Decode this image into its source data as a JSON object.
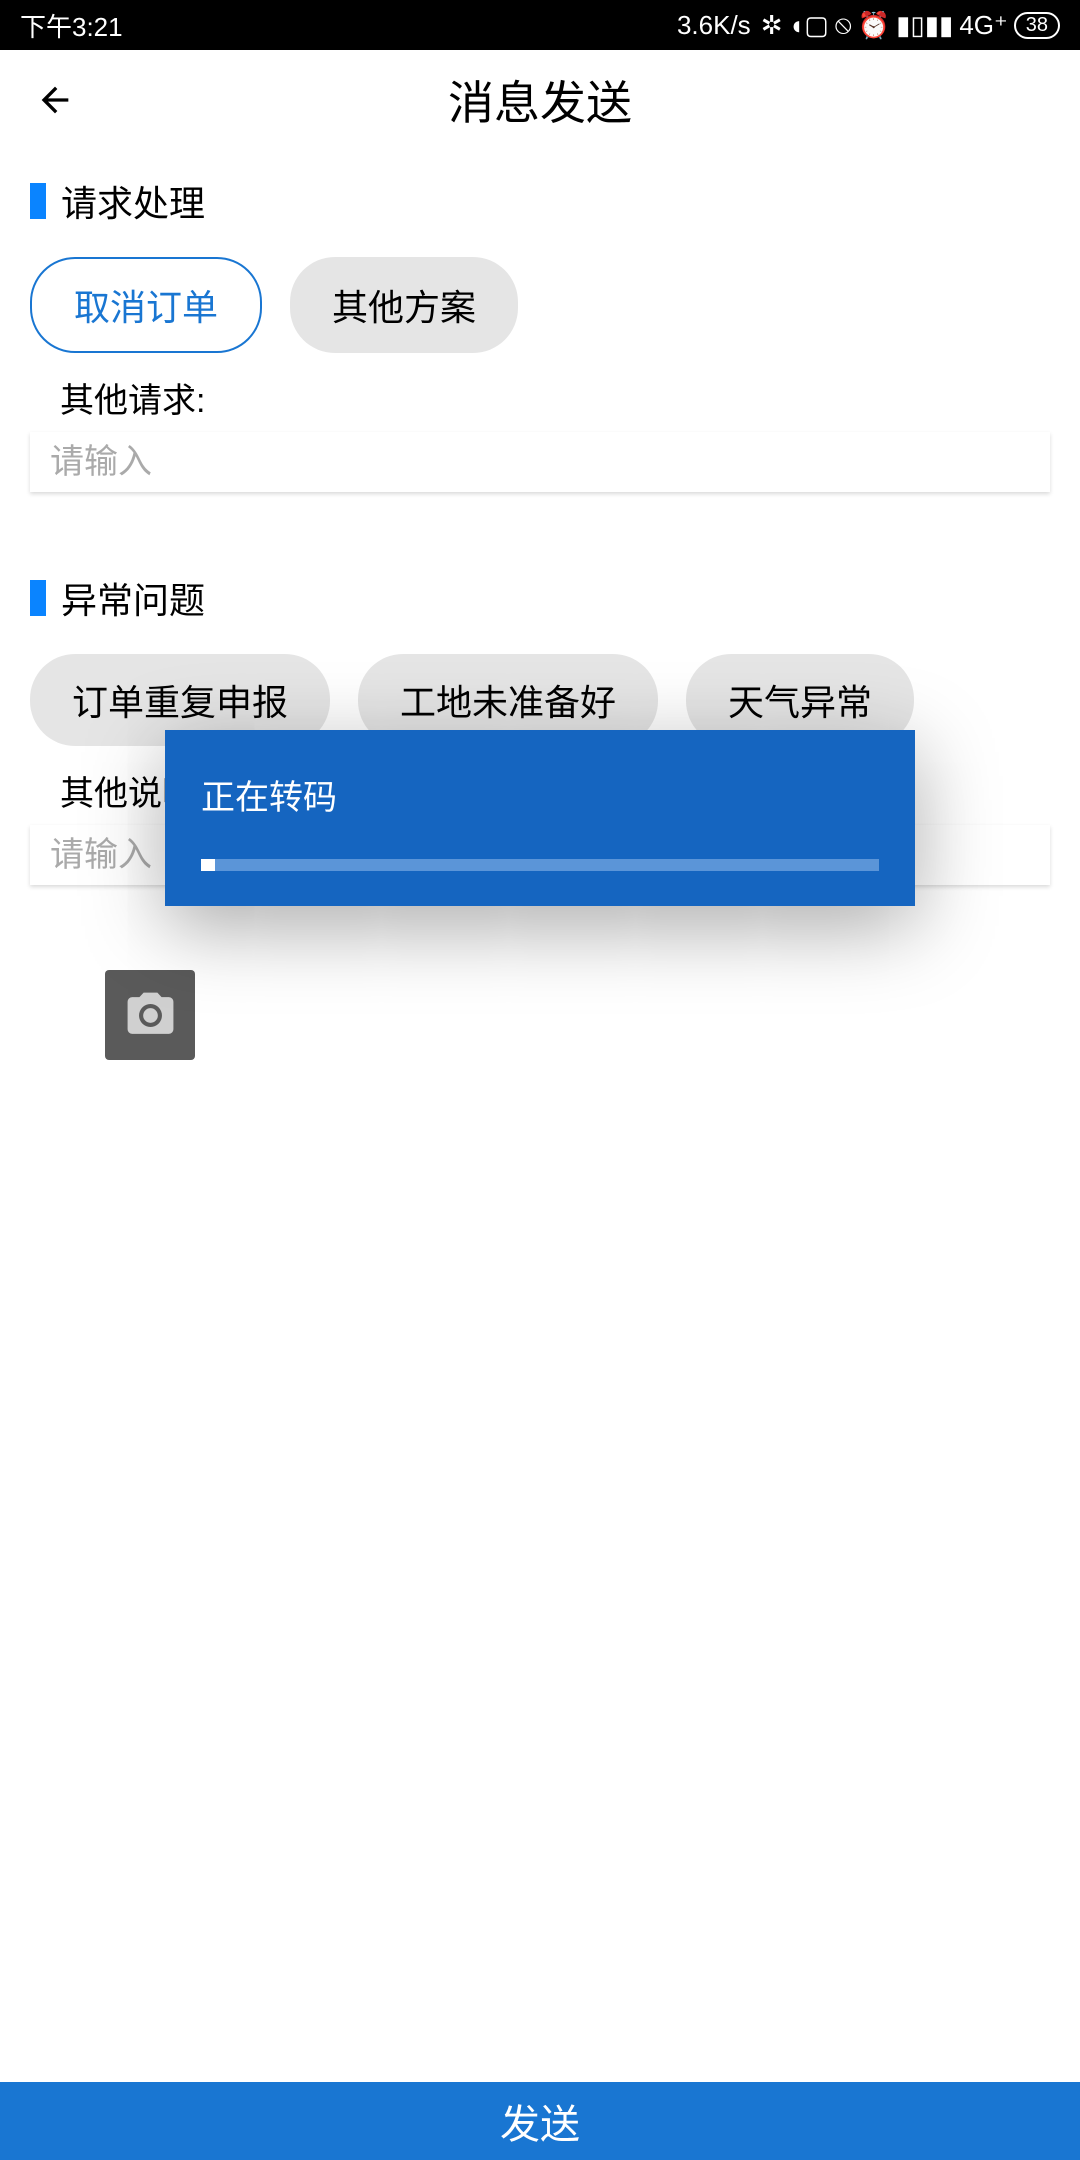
{
  "status_bar": {
    "time": "下午3:21",
    "speed": "3.6K/s",
    "network": "4G⁺",
    "battery": "38"
  },
  "header": {
    "title": "消息发送"
  },
  "section1": {
    "title": "请求处理",
    "chips": {
      "cancel_order": "取消订单",
      "other_plan": "其他方案"
    },
    "field_label": "其他请求:",
    "placeholder": "请输入"
  },
  "section2": {
    "title": "异常问题",
    "chips": {
      "duplicate": "订单重复申报",
      "site_not_ready": "工地未准备好",
      "weather": "天气异常"
    },
    "field_label": "其他说明:",
    "placeholder": "请输入"
  },
  "footer": {
    "send": "发送"
  },
  "dialog": {
    "title": "正在转码",
    "progress_percent": 2
  }
}
